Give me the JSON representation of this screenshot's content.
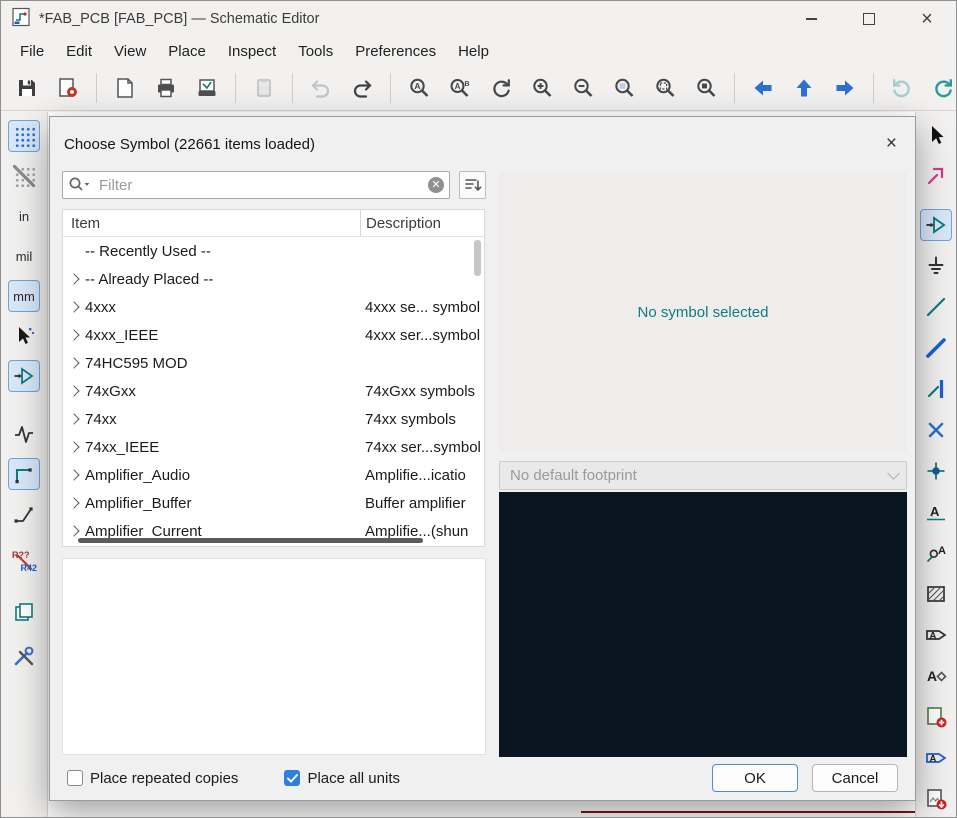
{
  "window": {
    "title": "*FAB_PCB [FAB_PCB] — Schematic Editor",
    "close_glyph": "×"
  },
  "menubar": {
    "items": [
      "File",
      "Edit",
      "View",
      "Place",
      "Inspect",
      "Tools",
      "Preferences",
      "Help"
    ]
  },
  "left_toolbar": {
    "unit_in": "in",
    "unit_mil": "mil",
    "unit_mm": "mm",
    "annotate_top": "R??",
    "annotate_bottom": "R42"
  },
  "dialog": {
    "title": "Choose Symbol (22661 items loaded)",
    "close_glyph": "×",
    "filter_placeholder": "Filter",
    "columns": {
      "item": "Item",
      "description": "Description"
    },
    "rows": [
      {
        "item": "-- Recently Used --",
        "desc": ""
      },
      {
        "item": "-- Already Placed --",
        "desc": ""
      },
      {
        "item": "4xxx",
        "desc": "4xxx se... symbol"
      },
      {
        "item": "4xxx_IEEE",
        "desc": "4xxx ser...symbol"
      },
      {
        "item": "74HC595 MOD",
        "desc": ""
      },
      {
        "item": "74xGxx",
        "desc": "74xGxx symbols"
      },
      {
        "item": "74xx",
        "desc": "74xx symbols"
      },
      {
        "item": "74xx_IEEE",
        "desc": "74xx ser...symbol"
      },
      {
        "item": "Amplifier_Audio",
        "desc": "Amplifie...icatio"
      },
      {
        "item": "Amplifier_Buffer",
        "desc": "Buffer amplifier"
      },
      {
        "item": "Amplifier_Current",
        "desc": "Amplifie...(shun"
      }
    ],
    "preview_message": "No symbol selected",
    "footprint_placeholder": "No default footprint",
    "checkbox_repeated": "Place repeated copies",
    "checkbox_all_units": "Place all units",
    "ok_label": "OK",
    "cancel_label": "Cancel"
  },
  "colors": {
    "accent_teal": "#0e7c80",
    "selection_blue": "#2f7fe0",
    "preview_bg": "#0a1522",
    "sheet_border_red": "#7d1410"
  }
}
